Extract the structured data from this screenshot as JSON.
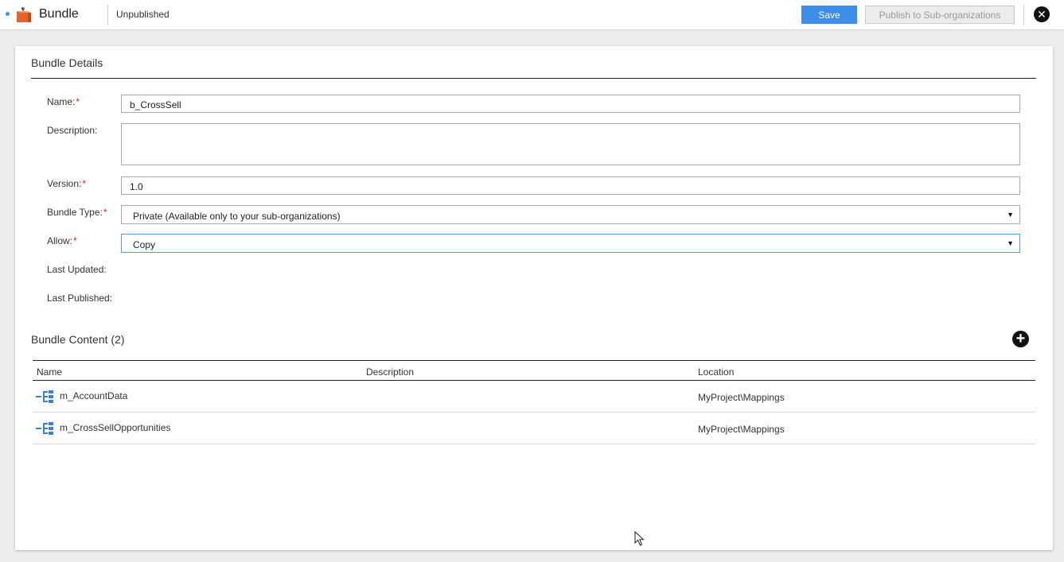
{
  "header": {
    "title": "Bundle",
    "publish_status": "Unpublished",
    "save_label": "Save",
    "publish_label": "Publish to Sub-organizations",
    "close_glyph": "✕"
  },
  "details": {
    "section_title": "Bundle Details",
    "name_label": "Name:",
    "name_value": "b_CrossSell",
    "description_label": "Description:",
    "description_value": "",
    "version_label": "Version:",
    "version_value": "1.0",
    "bundle_type_label": "Bundle Type:",
    "bundle_type_value": "Private (Available only to your sub-organizations)",
    "allow_label": "Allow:",
    "allow_value": "Copy",
    "last_updated_label": "Last Updated:",
    "last_published_label": "Last Published:",
    "required_marker": "*",
    "dropdown_glyph": "▼"
  },
  "content": {
    "section_title": "Bundle Content (2)",
    "add_glyph": "+",
    "columns": [
      "Name",
      "Description",
      "Location"
    ],
    "rows": [
      {
        "name": "m_AccountData",
        "description": "",
        "location": "MyProject\\Mappings"
      },
      {
        "name": "m_CrossSellOpportunities",
        "description": "",
        "location": "MyProject\\Mappings"
      }
    ]
  },
  "colors": {
    "accent": "#3d8ee8",
    "required": "#d9261c",
    "icon_orange": "#e8622c",
    "mapping_icon": "#3d7fd8"
  },
  "icons": {
    "bundle": "bundle-box-icon",
    "close": "close-icon",
    "add": "add-circle-icon",
    "mapping": "mapping-icon",
    "dropdown": "chevron-down-icon"
  }
}
